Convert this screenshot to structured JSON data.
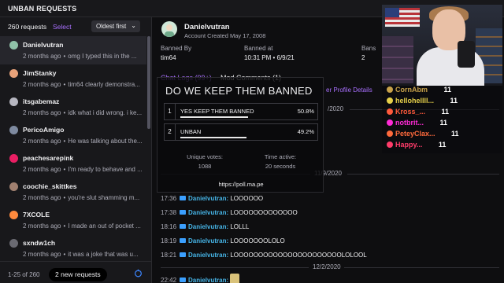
{
  "topbar": {
    "title": "UNBAN REQUESTS"
  },
  "left": {
    "count": "260 requests",
    "select": "Select",
    "sort": "Oldest first",
    "items": [
      {
        "name": "Danielvutran",
        "age": "2 months ago",
        "snippet": "omg I typed this in the ...",
        "color": "#8fc1a8"
      },
      {
        "name": "JimStanky",
        "age": "2 months ago",
        "snippet": "tim64 clearly demonstra...",
        "color": "#e8a27a"
      },
      {
        "name": "itsgabemaz",
        "age": "2 months ago",
        "snippet": "idk what i did wrong. i ke...",
        "color": "#b6b6c0"
      },
      {
        "name": "PericoAmigo",
        "age": "2 months ago",
        "snippet": "He was talking about the...",
        "color": "#7e8aa0"
      },
      {
        "name": "peachesarepink",
        "age": "2 months ago",
        "snippet": "I'm ready to behave and ...",
        "color": "#e91e63"
      },
      {
        "name": "coochie_skittkes",
        "age": "2 months ago",
        "snippet": "you're slut shamming m...",
        "color": "#a08070"
      },
      {
        "name": "7XCOLE",
        "age": "2 months ago",
        "snippet": "I made an out of pocket ...",
        "color": "#ff8a3d"
      },
      {
        "name": "sxndw1ch",
        "age": "2 months ago",
        "snippet": "it was a joke that was u...",
        "color": "#6a6a72"
      }
    ],
    "page_range": "1-25 of 260",
    "new_requests": "2 new requests"
  },
  "user": {
    "name": "Danielvutran",
    "created": "Account Created May 17, 2008",
    "banned_by_label": "Banned By",
    "banned_by": "tim64",
    "banned_at_label": "Banned at",
    "banned_at": "10:31 PM • 6/9/21",
    "bans_label": "Bans",
    "bans": "2"
  },
  "tabs": {
    "chat_logs": "Chat Logs (99+)",
    "mod_comments": "Mod Comments (1)",
    "profile": "er Profile Details"
  },
  "chat": {
    "dates": [
      "/2020",
      "11/9/2020",
      "12/2/2020"
    ],
    "lines": [
      {
        "time": "17:36",
        "user": "Danielvutran:",
        "msg": "LOOOOOO"
      },
      {
        "time": "17:38",
        "user": "Danielvutran:",
        "msg": "LOOOOOOOOOOOOO"
      },
      {
        "time": "18:16",
        "user": "Danielvutran:",
        "msg": "LOLLL"
      },
      {
        "time": "18:19",
        "user": "Danielvutran:",
        "msg": "LOOOOOOOLOLO"
      },
      {
        "time": "18:21",
        "user": "Danielvutran:",
        "msg": "LOOOOOOOOOOOOOOOOOOOOOOLOLOOL"
      },
      {
        "time": "22:42",
        "user": "Danielvutran:",
        "msg": ""
      }
    ]
  },
  "poll": {
    "title": "DO WE KEEP THEM BANNED",
    "options": [
      {
        "num": "1",
        "text": "YES KEEP THEM BANNED",
        "pct": "50.8%",
        "fraction": 0.508
      },
      {
        "num": "2",
        "text": "UNBAN",
        "pct": "49.2%",
        "fraction": 0.492
      }
    ],
    "votes_label": "Unique votes:",
    "votes": "1088",
    "time_label": "Time active:",
    "time": "20 seconds",
    "url": "https://poll.ma.pe"
  },
  "stream_chat": [
    {
      "name": "CornAbm",
      "count": "11",
      "color": "#c8a24a"
    },
    {
      "name": "hellohellll...",
      "count": "11",
      "color": "#e6d04a"
    },
    {
      "name": "Kross_...",
      "count": "11",
      "color": "#ff5a3c"
    },
    {
      "name": "notbrit...",
      "count": "11",
      "color": "#ff2bd6"
    },
    {
      "name": "PeteyClax...",
      "count": "11",
      "color": "#ff6a3c"
    },
    {
      "name": "Happy...",
      "count": "11",
      "color": "#ff3c6a"
    }
  ]
}
